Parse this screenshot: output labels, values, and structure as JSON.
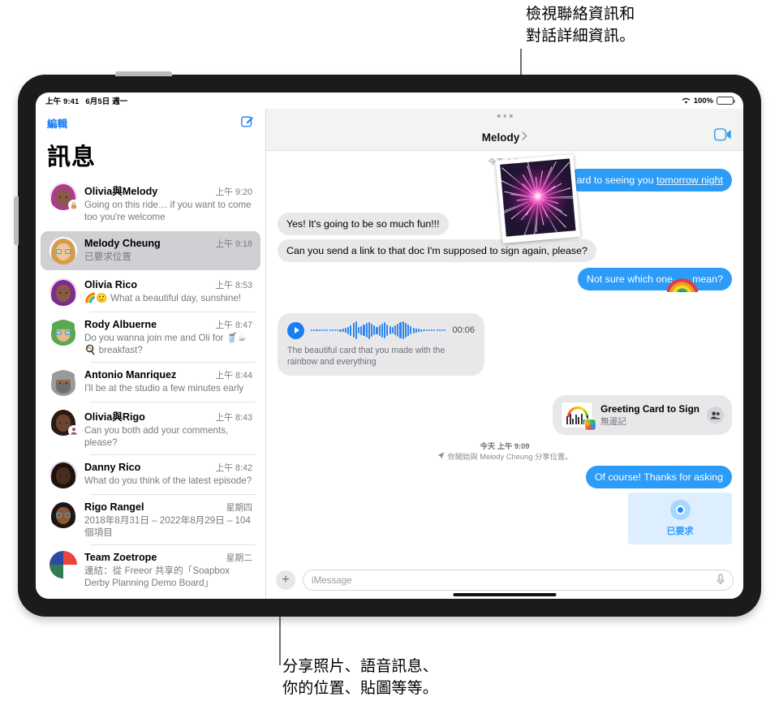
{
  "callouts": {
    "top": "檢視聯絡資訊和\n對話詳細資訊。",
    "bottom": "分享照片、語音訊息、\n你的位置、貼圖等等。"
  },
  "status_bar": {
    "time": "上午 9:41",
    "date": "6月5日 週一",
    "wifi_icon": "wifi-icon",
    "battery_percent": "100%"
  },
  "sidebar": {
    "edit_label": "編輯",
    "compose_icon": "compose-icon",
    "title": "訊息",
    "conversations": [
      {
        "name": "Olivia與Melody",
        "time": "上午 9:20",
        "preview": "Going on this ride… if you want to come too you're welcome",
        "avatar": "avatar-olivia-melody",
        "selected": false
      },
      {
        "name": "Melody Cheung",
        "time": "上午 9:18",
        "preview": "已要求位置",
        "avatar": "avatar-melody-cheung",
        "selected": true
      },
      {
        "name": "Olivia Rico",
        "time": "上午 8:53",
        "preview": "🌈🙂 What a beautiful day, sunshine!",
        "avatar": "avatar-olivia-rico",
        "selected": false
      },
      {
        "name": "Rody Albuerne",
        "time": "上午 8:47",
        "preview": "Do you wanna join me and Oli for 🥤☕🍳 breakfast?",
        "avatar": "avatar-rody-albuerne",
        "selected": false
      },
      {
        "name": "Antonio Manriquez",
        "time": "上午 8:44",
        "preview": "I'll be at the studio a few minutes early",
        "avatar": "avatar-antonio-manriquez",
        "selected": false
      },
      {
        "name": "Olivia與Rigo",
        "time": "上午 8:43",
        "preview": "Can you both add your comments, please?",
        "avatar": "avatar-olivia-rigo",
        "selected": false
      },
      {
        "name": "Danny Rico",
        "time": "上午 8:42",
        "preview": "What do you think of the latest episode?",
        "avatar": "avatar-danny-rico",
        "selected": false
      },
      {
        "name": "Rigo Rangel",
        "time": "星期四",
        "preview": "2018年8月31日 – 2022年8月29日 – 104個項目",
        "avatar": "avatar-rigo-rangel",
        "selected": false
      },
      {
        "name": "Team Zoetrope",
        "time": "星期二",
        "preview": "連結：從 Freeor 共享的「Soapbox Derby Planning Demo Board」",
        "avatar": "avatar-team-zoetrope",
        "selected": false
      }
    ]
  },
  "conversation": {
    "title": "Melody",
    "chevron_icon": "chevron-right-icon",
    "facetime_icon": "facetime-video-icon",
    "multitask_icon": "multitask-dots-icon",
    "day_stamp": "今天 上午",
    "photo_attachment": "fireworks-photo",
    "messages": [
      {
        "dir": "out",
        "text": "ard to seeing you ",
        "link_text": "tomorrow night"
      },
      {
        "dir": "in",
        "text": "Yes! It's going to be so much fun!!!"
      },
      {
        "dir": "in",
        "text": "Can you send a link to that doc I'm supposed to sign again, please?"
      },
      {
        "dir": "out",
        "text": "Not sure which one ",
        "text2": " mean?",
        "sticker": "rainbow-sticker"
      }
    ],
    "audio_message": {
      "play_icon": "play-icon",
      "duration": "00:06",
      "transcript": "The beautiful card that you made with the rainbow and everything"
    },
    "link_card": {
      "title": "Greeting Card to Sign",
      "subtitle": "無邊記",
      "thumb_icon": "greeting-card-thumbnail",
      "people_icon": "shared-people-icon"
    },
    "location_notice": {
      "time": "今天 上午 9:09",
      "arrow_icon": "location-arrow-icon",
      "text": "你開始與 Melody Cheung 分享位置。"
    },
    "last_message": "Of course! Thanks for asking",
    "location_card": {
      "label": "已要求",
      "dot_icon": "location-dot-icon"
    }
  },
  "input_bar": {
    "plus_icon": "plus-icon",
    "placeholder": "iMessage",
    "mic_icon": "microphone-icon"
  },
  "colors": {
    "accent_blue": "#2d9bf8",
    "link_blue": "#1279f2",
    "bubble_gray": "#e8e8ea",
    "selected_row": "#cfcfd4"
  }
}
